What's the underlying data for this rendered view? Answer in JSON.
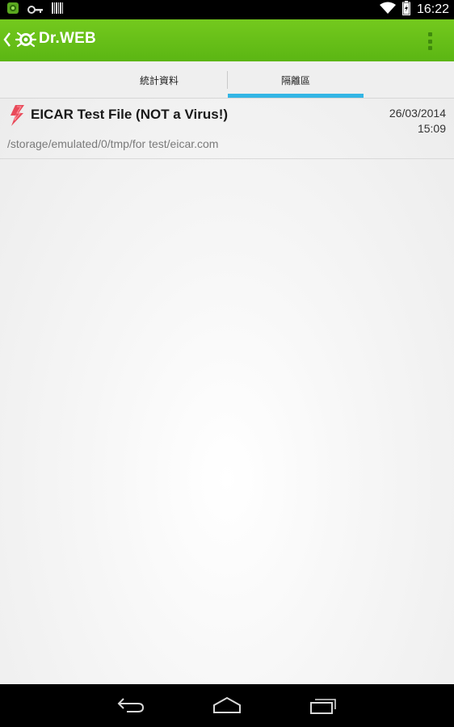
{
  "status_bar": {
    "time": "16:22",
    "icons": [
      "app-notification-icon",
      "key-icon",
      "barcode-icon",
      "wifi-icon",
      "battery-icon"
    ]
  },
  "action_bar": {
    "title": "Dr.WEB",
    "brand_color": "#5bb613"
  },
  "tabs": [
    {
      "label": "統計資料",
      "selected": false
    },
    {
      "label": "隔離區",
      "selected": true
    }
  ],
  "tab_indicator_color": "#33b5e5",
  "quarantine": {
    "items": [
      {
        "name": "EICAR Test File (NOT a Virus!)",
        "date": "26/03/2014",
        "time": "15:09",
        "path": "/storage/emulated/0/tmp/for test/eicar.com",
        "icon": "lightning-threat-icon",
        "icon_color": "#e84b5a"
      }
    ]
  },
  "nav_bar": {
    "buttons": [
      "back-icon",
      "home-icon",
      "recents-icon"
    ]
  }
}
